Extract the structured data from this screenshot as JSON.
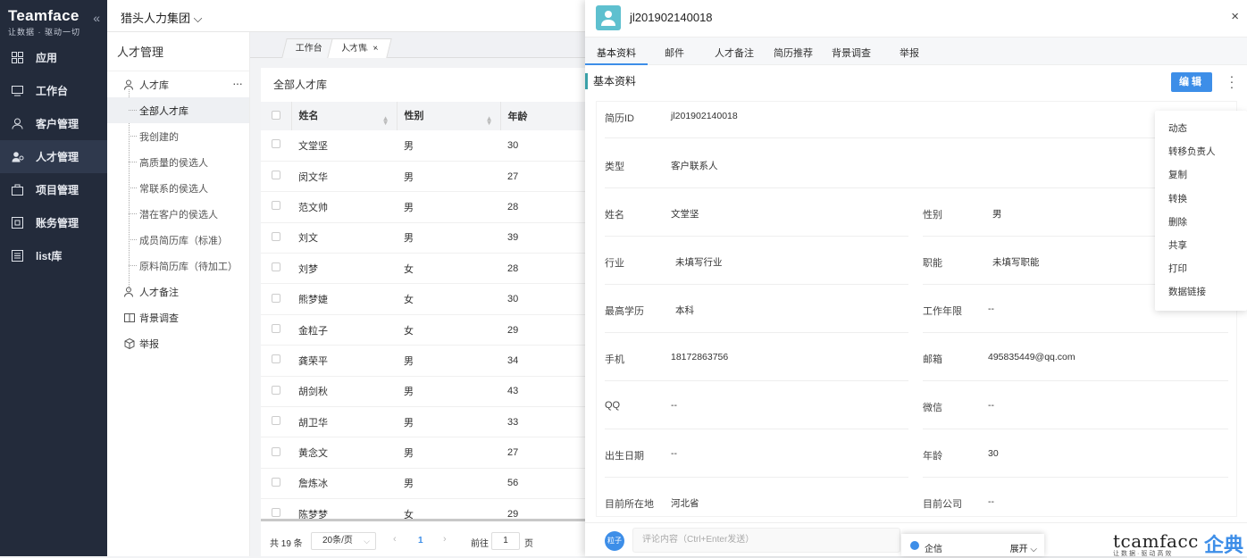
{
  "sidebar": {
    "logo": "Teamface",
    "slogan": "让数据 · 驱动一切",
    "collapse": "«",
    "items": [
      {
        "label": "应用",
        "icon": "apps-icon"
      },
      {
        "label": "工作台",
        "icon": "monitor-icon"
      },
      {
        "label": "客户管理",
        "icon": "customer-icon"
      },
      {
        "label": "人才管理",
        "icon": "people-icon"
      },
      {
        "label": "项目管理",
        "icon": "project-icon"
      },
      {
        "label": "账务管理",
        "icon": "finance-icon"
      },
      {
        "label": "list库",
        "icon": "list-icon"
      }
    ]
  },
  "topbar": {
    "company": "猎头人力集团 ⌵"
  },
  "subnav": {
    "title": "人才管理",
    "talent_pool": "人才库",
    "more": "···",
    "children": [
      "全部人才库",
      "我创建的",
      "高质量的侯选人",
      "常联系的侯选人",
      "潜在客户的侯选人",
      "成员简历库（标准）",
      "原料简历库（待加工）"
    ],
    "other": [
      "人才备注",
      "背景调查",
      "举报"
    ]
  },
  "tabs": {
    "t1": "工作台",
    "t2": "人才库",
    "close": "×"
  },
  "list": {
    "title": "全部人才库",
    "headers": [
      "姓名",
      "性别",
      "年龄"
    ],
    "rows": [
      [
        "文堂坚",
        "男",
        "30"
      ],
      [
        "闵文华",
        "男",
        "27"
      ],
      [
        "范文帅",
        "男",
        "28"
      ],
      [
        "刘文",
        "男",
        "39"
      ],
      [
        "刘梦",
        "女",
        "28"
      ],
      [
        "熊梦婕",
        "女",
        "30"
      ],
      [
        "金粒子",
        "女",
        "29"
      ],
      [
        "龚荣平",
        "男",
        "34"
      ],
      [
        "胡剑秋",
        "男",
        "43"
      ],
      [
        "胡卫华",
        "男",
        "33"
      ],
      [
        "黄念文",
        "男",
        "27"
      ],
      [
        "詹炼冰",
        "男",
        "56"
      ],
      [
        "陈梦梦",
        "女",
        "29"
      ]
    ]
  },
  "pager": {
    "total": "共 19 条",
    "size": "20条/页",
    "page": "1",
    "goto": "前往",
    "goto_val": "1",
    "unit": "页"
  },
  "detail": {
    "id": "jl201902140018",
    "close": "×",
    "tabs": [
      "基本资料",
      "邮件",
      "人才备注",
      "简历推荐",
      "背景调查",
      "举报"
    ],
    "section": "基本资料",
    "edit": "编辑",
    "fields": {
      "resume_id_label": "简历ID",
      "resume_id": "jl201902140018",
      "type_label": "类型",
      "type": "客户联系人",
      "name_label": "姓名",
      "name": "文堂坚",
      "gender_label": "性别",
      "gender": "男",
      "industry_label": "行业",
      "industry": "未填写行业",
      "function_label": "职能",
      "function": "未填写职能",
      "edu_label": "最高学历",
      "edu": "本科",
      "years_label": "工作年限",
      "years": "--",
      "phone_label": "手机",
      "phone": "18172863756",
      "email_label": "邮箱",
      "email": "495835449@qq.com",
      "qq_label": "QQ",
      "qq": "--",
      "wechat_label": "微信",
      "wechat": "--",
      "birth_label": "出生日期",
      "birth": "--",
      "age_label": "年龄",
      "age": "30",
      "loc_label": "目前所在地",
      "loc": "河北省",
      "company_label": "目前公司",
      "company": "--"
    },
    "comment": {
      "avatar": "粒子",
      "placeholder": "评论内容（Ctrl+Enter发送）"
    }
  },
  "menu": [
    "动态",
    "转移负责人",
    "复制",
    "转换",
    "删除",
    "共享",
    "打印",
    "数据链接"
  ],
  "qixin": {
    "label": "企信",
    "expand": "展开 ⌵"
  },
  "watermark": {
    "en": "tcamfacc",
    "cn": "企典",
    "sub": "让数据·驱动高效"
  }
}
